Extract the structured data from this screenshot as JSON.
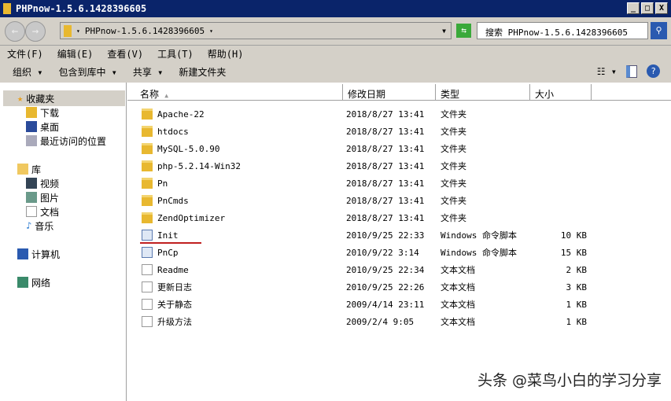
{
  "window": {
    "title": "PHPnow-1.5.6.1428396605"
  },
  "address": {
    "path": "PHPnow-1.5.6.1428396605",
    "search_placeholder": "搜索 PHPnow-1.5.6.1428396605"
  },
  "menu": [
    "文件(F)",
    "编辑(E)",
    "查看(V)",
    "工具(T)",
    "帮助(H)"
  ],
  "toolbar": [
    "组织 ▾",
    "包含到库中 ▾",
    "共享 ▾",
    "新建文件夹"
  ],
  "sidebar": {
    "favorites": "收藏夹",
    "fav_items": [
      "下载",
      "桌面",
      "最近访问的位置"
    ],
    "libraries": "库",
    "lib_items": [
      "视频",
      "图片",
      "文档",
      "音乐"
    ],
    "computer": "计算机",
    "network": "网络"
  },
  "columns": [
    "名称",
    "修改日期",
    "类型",
    "大小"
  ],
  "files": [
    {
      "name": "Apache-22",
      "date": "2018/8/27 13:41",
      "type": "文件夹",
      "size": "",
      "icon": "folder"
    },
    {
      "name": "htdocs",
      "date": "2018/8/27 13:41",
      "type": "文件夹",
      "size": "",
      "icon": "folder"
    },
    {
      "name": "MySQL-5.0.90",
      "date": "2018/8/27 13:41",
      "type": "文件夹",
      "size": "",
      "icon": "folder"
    },
    {
      "name": "php-5.2.14-Win32",
      "date": "2018/8/27 13:41",
      "type": "文件夹",
      "size": "",
      "icon": "folder"
    },
    {
      "name": "Pn",
      "date": "2018/8/27 13:41",
      "type": "文件夹",
      "size": "",
      "icon": "folder"
    },
    {
      "name": "PnCmds",
      "date": "2018/8/27 13:41",
      "type": "文件夹",
      "size": "",
      "icon": "folder"
    },
    {
      "name": "ZendOptimizer",
      "date": "2018/8/27 13:41",
      "type": "文件夹",
      "size": "",
      "icon": "folder"
    },
    {
      "name": "Init",
      "date": "2010/9/25 22:33",
      "type": "Windows 命令脚本",
      "size": "10 KB",
      "icon": "cmd"
    },
    {
      "name": "PnCp",
      "date": "2010/9/22 3:14",
      "type": "Windows 命令脚本",
      "size": "15 KB",
      "icon": "cmd"
    },
    {
      "name": "Readme",
      "date": "2010/9/25 22:34",
      "type": "文本文档",
      "size": "2 KB",
      "icon": "doc"
    },
    {
      "name": "更新日志",
      "date": "2010/9/25 22:26",
      "type": "文本文档",
      "size": "3 KB",
      "icon": "doc"
    },
    {
      "name": "关于静态",
      "date": "2009/4/14 23:11",
      "type": "文本文档",
      "size": "1 KB",
      "icon": "doc"
    },
    {
      "name": "升级方法",
      "date": "2009/2/4 9:05",
      "type": "文本文档",
      "size": "1 KB",
      "icon": "doc"
    }
  ],
  "watermark": "头条 @菜鸟小白的学习分享"
}
